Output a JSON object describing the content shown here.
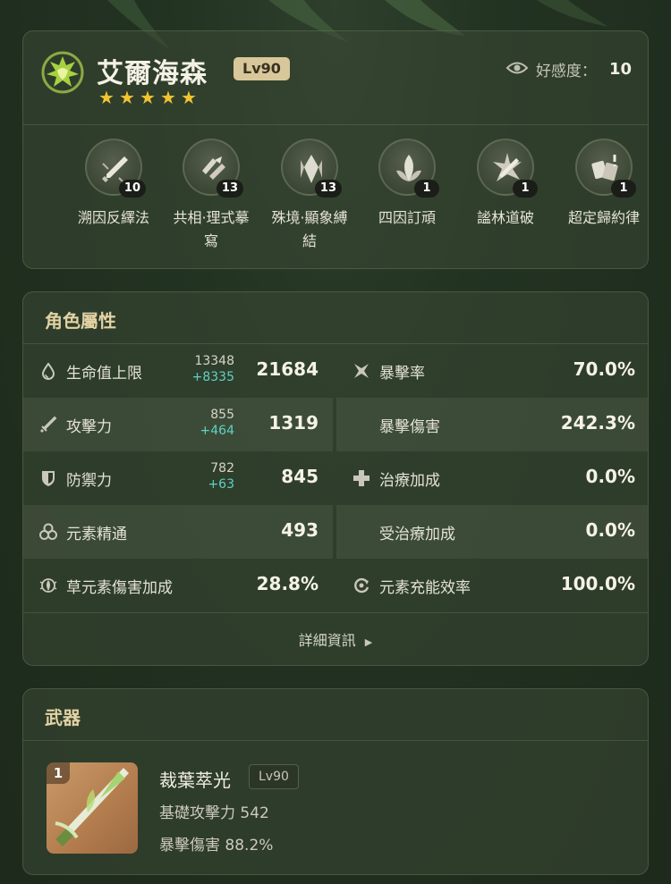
{
  "character": {
    "name": "艾爾海森",
    "level": "Lv90",
    "stars": 5,
    "favor_label": "好感度：",
    "favor_value": "10",
    "accent": "#a7d240"
  },
  "talents": [
    {
      "label_line1": "溯因反繹法",
      "label_line2": "",
      "count": "10",
      "icon": "sword-icon"
    },
    {
      "label_line1": "共相·理式摹",
      "label_line2": "寫",
      "count": "13",
      "icon": "leaf-cards-icon"
    },
    {
      "label_line1": "殊境·顯象縛",
      "label_line2": "結",
      "count": "13",
      "icon": "crystal-icon"
    },
    {
      "label_line1": "四因訂頑",
      "label_line2": "",
      "count": "1",
      "icon": "leaf-emblem-icon"
    },
    {
      "label_line1": "謐林道破",
      "label_line2": "",
      "count": "1",
      "icon": "sword-burst-icon"
    },
    {
      "label_line1": "超定歸約律",
      "label_line2": "",
      "count": "1",
      "icon": "cards-icon"
    }
  ],
  "attributes": {
    "title": "角色屬性",
    "rows": [
      {
        "left": {
          "label": "生命值上限",
          "base": "13348",
          "bonus": "+8335",
          "total": "21684",
          "icon": "hp-drop-icon"
        },
        "right": {
          "label": "暴擊率",
          "total": "70.0%",
          "icon": "crit-rate-icon"
        }
      },
      {
        "left": {
          "label": "攻擊力",
          "base": "855",
          "bonus": "+464",
          "total": "1319",
          "icon": "attack-sword-icon"
        },
        "right": {
          "label": "暴擊傷害",
          "total": "242.3%",
          "icon": ""
        }
      },
      {
        "left": {
          "label": "防禦力",
          "base": "782",
          "bonus": "+63",
          "total": "845",
          "icon": "shield-icon"
        },
        "right": {
          "label": "治療加成",
          "total": "0.0%",
          "icon": "plus-cross-icon"
        }
      },
      {
        "left": {
          "label": "元素精通",
          "base": "",
          "bonus": "",
          "total": "493",
          "icon": "em-circles-icon"
        },
        "right": {
          "label": "受治療加成",
          "total": "0.0%",
          "icon": ""
        }
      },
      {
        "left": {
          "label": "草元素傷害加成",
          "base": "",
          "bonus": "",
          "total": "28.8%",
          "icon": "dendro-icon"
        },
        "right": {
          "label": "元素充能效率",
          "total": "100.0%",
          "icon": "energy-recharge-icon"
        }
      }
    ],
    "detail_link": "詳細資訊"
  },
  "weapon": {
    "section_title": "武器",
    "refinement": "1",
    "name": "裁葉萃光",
    "level": "Lv90",
    "stat1": "基礎攻擊力 542",
    "stat2": "暴擊傷害 88.2%"
  }
}
